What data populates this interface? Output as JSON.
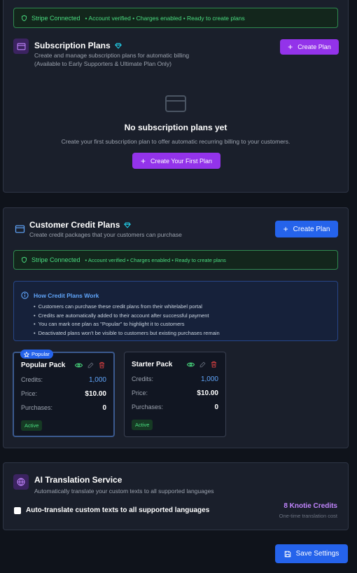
{
  "subscription": {
    "stripe": {
      "title": "Stripe Connected",
      "details": "• Account verified • Charges enabled • Ready to create plans"
    },
    "title": "Subscription Plans",
    "desc_line1": "Create and manage subscription plans for automatic billing",
    "desc_line2": "(Available to Early Supporters & Ultimate Plan Only)",
    "create_button": "Create Plan",
    "empty_title": "No subscription plans yet",
    "empty_desc": "Create your first subscription plan to offer automatic recurring billing to your customers.",
    "first_button": "Create Your First Plan"
  },
  "credit": {
    "title": "Customer Credit Plans",
    "desc": "Create credit packages that your customers can purchase",
    "create_button": "Create Plan",
    "stripe": {
      "title": "Stripe Connected",
      "details": "• Account verified • Charges enabled • Ready to create plans"
    },
    "info": {
      "title": "How Credit Plans Work",
      "items": [
        "Customers can purchase these credit plans from their whitelabel portal",
        "Credits are automatically added to their account after successful payment",
        "You can mark one plan as \"Popular\" to highlight it to customers",
        "Deactivated plans won't be visible to customers but existing purchases remain"
      ]
    },
    "labels": {
      "credits": "Credits:",
      "price": "Price:",
      "purchases": "Purchases:"
    },
    "plans": [
      {
        "badge": "Popular",
        "name": "Popular Pack",
        "credits": "1,000",
        "price": "$10.00",
        "purchases": "0",
        "status": "Active"
      },
      {
        "name": "Starter Pack",
        "credits": "1,000",
        "price": "$10.00",
        "purchases": "0",
        "status": "Active"
      }
    ]
  },
  "ai": {
    "title": "AI Translation Service",
    "desc": "Automatically translate your custom texts to all supported languages",
    "checkbox_label": "Auto-translate custom texts to all supported languages",
    "checkbox_checked": false,
    "credits": "8 Knotie Credits",
    "credits_sub": "One-time translation cost"
  },
  "save_button": "Save Settings",
  "colors": {
    "background": "#0f131b",
    "card": "#1a1f2b",
    "success": "#4ade80",
    "purple": "#9333ea",
    "blue": "#2563eb"
  }
}
